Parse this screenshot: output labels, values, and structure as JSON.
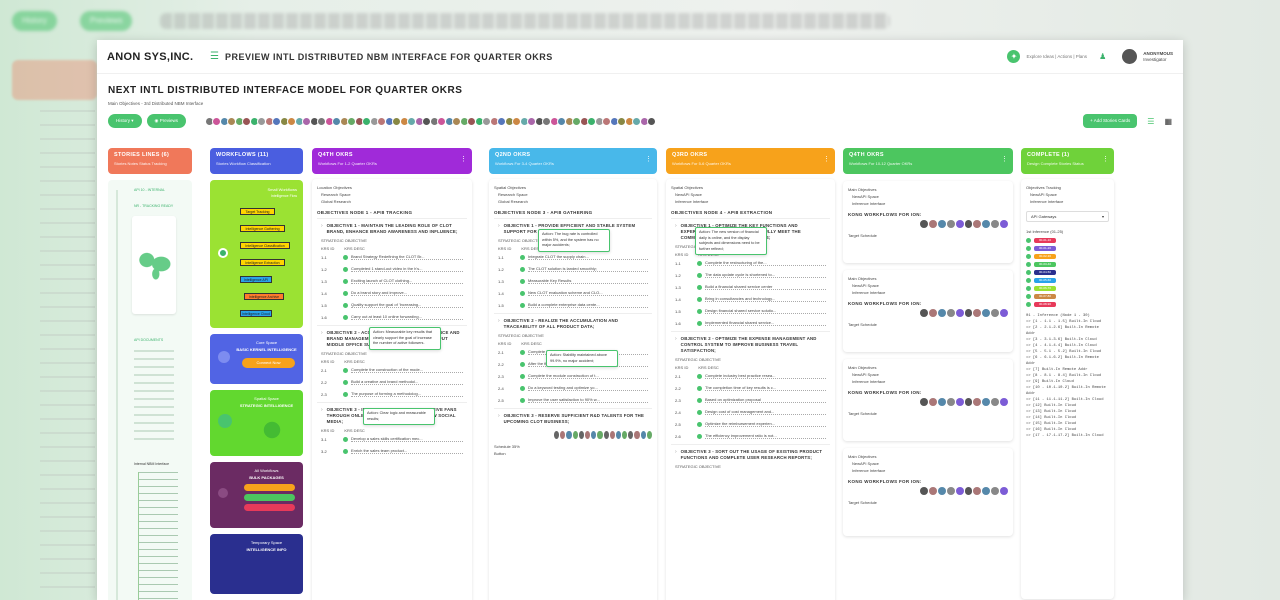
{
  "background": {
    "pills": [
      "History",
      "Previews"
    ]
  },
  "app": {
    "logo": "ANON SYS,INC.",
    "page_title": "PREVIEW INTL DISTRIBUTED NBM INTERFACE FOR QUARTER OKRS",
    "explore_text": "Explore Ideas | Actions | Plans",
    "user_name": "ANONYMOUS",
    "user_role": "Investigator"
  },
  "board": {
    "title": "NEXT INTL DISTRIBUTED INTERFACE MODEL FOR QUARTER OKRS",
    "subtitle": "Main Objectives - 3rd Distributed NBM Interface",
    "history_label": "History",
    "previews_label": "Previews",
    "add_card_label": "Add Stories Cards"
  },
  "colors": {
    "accent": "#49c46e",
    "stories": "#f0785a",
    "workflows": "#4a5ee0",
    "okr_purple": "#a02ad9",
    "okr_blue": "#48b8ea",
    "okr_orange": "#f7a21b",
    "okr_green": "#4cc65f",
    "complete": "#6fd23a"
  },
  "columns": {
    "stories": {
      "title": "STORIES LINES (6)",
      "subtitle": "Stories Notes Status Tracking",
      "items": [
        "API 10 - INTERNAL",
        "NR - TRACKING READY",
        "API DOCUMENTS",
        "Internal NBM Interface"
      ]
    },
    "workflows": {
      "title": "WORKFLOWS (11)",
      "subtitle": "Stories Workflow Classification",
      "flow_title": "Small Workflows",
      "flow_sub": "Intelligence Flow",
      "flow_steps": [
        "Target Tracking",
        "Intelligence Gathering",
        "Intelligence Classification",
        "Intelligence Extraction",
        "Intelligence API",
        "Intelligence Archive",
        "Intelligence Cloud"
      ],
      "card2_title": "Core Space",
      "card2_sub": "BASIC KERNEL INTELLIGENCE",
      "card2_btn": "Connect Now",
      "card3_title": "Spatial Space",
      "card3_sub": "STRATEGIC INTELLIGENCE",
      "card4_title": "All Workflows",
      "card4_sub": "BULK PACKAGES",
      "card5_title": "Temporary Space",
      "card5_sub": "INTELLIGENCE INFO"
    },
    "okr1": {
      "title": "Q4TH OKRS",
      "subtitle": "Workflows For 1-2 Quarter OKRs",
      "meta": [
        "Location Objectives",
        "Research Space",
        "Global Research"
      ],
      "section": "OBJECTIVES NODE 1 - API8 TRACKING",
      "objectives": [
        {
          "title": "OBJECTIVE 1 - MAINTAIN THE LEADING ROLE OF CLOT BRAND, ENHANCE BRAND AWARENESS AND INFLUENCE;",
          "strategic": "STRATEGIC OBJECTIVE",
          "kr_id": "KRS ID",
          "kr_desc": "KRS DESC",
          "krs": [
            [
              "1-1",
              "Brand Strategy Redefining the CLOT Br..."
            ],
            [
              "1-2",
              "Completed 1 stand-out video in the h's..."
            ],
            [
              "1-3",
              "Exciting launch of CLOT clothing..."
            ],
            [
              "1-4",
              "Do a brand story and improve..."
            ],
            [
              "1-5",
              "Quality support the goal of 'Increasing..."
            ],
            [
              "1-6",
              "Carry out at least 10 online forwarding..."
            ]
          ],
          "tip": "Action: Measurable key results that clearly support the goal of increase the number of active followers."
        },
        {
          "title": "OBJECTIVE 2 - ACCUMULATE CREATIVE EXPERIENCE AND BRAND MANAGEMENT METHODOLOGY, AND OUTPUT MIDDLE OFFICE SUPPORT CAPABILITIES;",
          "strategic": "STRATEGIC OBJECTIVE",
          "kr_id": "KRS ID",
          "kr_desc": "KRS DESC",
          "krs": [
            [
              "2-1",
              "Complete the construction of the mode..."
            ],
            [
              "2-2",
              "Build a creative and brand methodol..."
            ],
            [
              "2-3",
              "The purpose of forming a methodolog..."
            ]
          ],
          "tip": "Action: Clear logic and measurable results;"
        },
        {
          "title": "OBJECTIVE 3 - INCREASE THE NUMBER OF ACTIVE FANS THROUGH ONLINE TRAFFIC ACTIVITIES ON NEW SOCIAL MEDIA;",
          "strategic": "",
          "kr_id": "KRS ID",
          "kr_desc": "KRS DESC",
          "krs": [
            [
              "3-1",
              "Develop a sales skills certification mec..."
            ],
            [
              "3-2",
              "Enrich the sales team product..."
            ]
          ],
          "tip": ""
        }
      ]
    },
    "okr2": {
      "title": "Q2ND OKRS",
      "subtitle": "Workflows For 3-4 Quarter OKRs",
      "meta": [
        "Spatial Objectives",
        "Research Space",
        "Global Research"
      ],
      "section": "OBJECTIVES NODE 3 - API8 GATHERING",
      "objectives": [
        {
          "title": "OBJECTIVE 1 - PROVIDE EFFICIENT AND STABLE SYSTEM SUPPORT FOR CLOT BUSINESS;",
          "strategic": "STRATEGIC OBJECTIVE",
          "kr_id": "KRS ID",
          "kr_desc": "KRS DESC",
          "krs": [
            [
              "1-1",
              "Integrate CLOT the supply chain..."
            ],
            [
              "1-2",
              "The CLOT solution is landed smoothly;"
            ],
            [
              "1-3",
              "Measurable Key Results"
            ],
            [
              "1-4",
              "New CLOT evaluation scheme and CLO..."
            ],
            [
              "1-5",
              "Build a complete enterprise data cente..."
            ]
          ],
          "tip": "Action: The bug rate is controlled within 5%, and the system has no major accidents;"
        },
        {
          "title": "OBJECTIVE 2 - REALIZE THE ACCUMULATION AND TRACEABILITY OF ALL PRODUCT DATA;",
          "strategic": "STRATEGIC OBJECTIVE",
          "kr_id": "KRS ID",
          "kr_desc": "KRS DESC",
          "krs": [
            [
              "2-1",
              "Complete data middle platform frame..."
            ],
            [
              "2-2",
              "After the first-generation version is rea..."
            ],
            [
              "2-3",
              "Complete the module construction of t..."
            ],
            [
              "2-4",
              "Do a keyword testing and optimize yo..."
            ],
            [
              "2-5",
              "Improve the user satisfaction to 90% w..."
            ]
          ],
          "tip": "Action: Stability maintained above 99.9%, no major accident;"
        },
        {
          "title": "OBJECTIVE 3 - RESERVE SUFFICIENT R&D TALENTS FOR THE UPCOMING CLOT BUSINESS;",
          "strategic": "",
          "kr_id": "",
          "kr_desc": "",
          "krs": [],
          "tip": ""
        }
      ],
      "footer_label": "Schedule 35%",
      "footer_btn": "Button"
    },
    "okr3": {
      "title": "Q3RD OKRS",
      "subtitle": "Workflows For 5-6 Quarter OKRs",
      "meta": [
        "Spatial Objectives",
        "NewAPI Space",
        "Inference Interface"
      ],
      "section": "OBJECTIVES NODE 4 - API8 EXTRACTION",
      "objectives": [
        {
          "title": "OBJECTIVE 1 - OPTIMIZE THE KEY FUNCTIONS AND EXPERIENCE OF THE PRODUCT TO FULLY MEET THE COMMERCIALIZATION REQUIREMENTS;",
          "strategic": "STRATEGIC OBJECTIVE",
          "kr_id": "KRS ID",
          "kr_desc": "KRS DESC",
          "krs": [
            [
              "1-1",
              "Complete the restructuring of the..."
            ],
            [
              "1-2",
              "The data update cycle is shortened to..."
            ],
            [
              "1-3",
              "Build a financial shared service center"
            ],
            [
              "1-4",
              "Bring in consultancies and technology..."
            ],
            [
              "1-5",
              "Design financial shared service solutio..."
            ],
            [
              "1-6",
              "Implemented financial shared service..."
            ]
          ],
          "tip": "Action: The new version of financial daily is online, and the display subjects and dimensions need to be further refined;"
        },
        {
          "title": "OBJECTIVE 2 - OPTIMIZE THE EXPENSE MANAGEMENT AND CONTROL SYSTEM TO IMPROVE BUSINESS TRAVEL SATISFACTION;",
          "strategic": "STRATEGIC OBJECTIVE",
          "kr_id": "KRS ID",
          "kr_desc": "KRS DESC",
          "krs": [
            [
              "2-1",
              "Complete industry best practice resea..."
            ],
            [
              "2-2",
              "The completion time of key results is c..."
            ],
            [
              "2-3",
              "Based on optimization proposal"
            ],
            [
              "2-4",
              "Design cost of cost management and..."
            ],
            [
              "2-5",
              "Optimize the reimbursement experien..."
            ],
            [
              "2-6",
              "The efficiency improvement ratio is not..."
            ]
          ],
          "tip": ""
        },
        {
          "title": "OBJECTIVE 3 - SORT OUT THE USAGE OF EXISTING PRODUCT FUNCTIONS AND COMPLETE USER RESEARCH REPORTS;",
          "strategic": "STRATEGIC OBJECTIVE",
          "kr_id": "",
          "kr_desc": "",
          "krs": [],
          "tip": ""
        }
      ]
    },
    "okr4": {
      "title": "Q4TH OKRS",
      "subtitle": "Workflows For 10-12 Quarter OKRs",
      "cards": [
        {
          "meta": [
            "Main Objectives",
            "NewAPI Space",
            "Inference Interface"
          ],
          "label": "KONG WORKFLOWS FOR ION:",
          "foot": "Target Schedule"
        },
        {
          "meta": [
            "Main Objectives",
            "NewAPI Space",
            "Inference Interface"
          ],
          "label": "KONG WORKFLOWS FOR ION:",
          "foot": "Target Schedule"
        },
        {
          "meta": [
            "Main Objectives",
            "NewAPI Space",
            "Inference Interface"
          ],
          "label": "KONG WORKFLOWS FOR ION:",
          "foot": "Target Schedule"
        },
        {
          "meta": [
            "Main Objectives",
            "NewAPI Space",
            "Inference Interface"
          ],
          "label": "KONG WORKFLOWS FOR ION:",
          "foot": "Target Schedule"
        }
      ]
    },
    "complete": {
      "title": "COMPLETE (1)",
      "subtitle": "Design Complete Stories Status",
      "meta": [
        "Objectives Tracking",
        "NewAPI Space",
        "Inference Interface"
      ],
      "dropdown": "API Gateways",
      "list_title": "1st Inference (01-25)",
      "tags": [
        "00-01-10",
        "00-01-20",
        "00-02-30",
        "00-03-40",
        "00-04-50",
        "00-05-60",
        "00-06-70",
        "00-07-80",
        "00-08-90"
      ],
      "lines": [
        "01 - Inference (Node 1 - 30)",
        "=> [1 - 1.1 - 1.5] Built-In Cloud",
        "=> [2 - 2.1-2.6] Built-In Remote Addr",
        "=> [3 - 3.1-3.6] Built-In Cloud",
        "=> [4 - 4.1-4.4] Built-In Cloud",
        "=> [5 - 5.1 - 5.2] Built-In Cloud",
        "=> [6 - 6.1-6.2] Built-In Remote Addr",
        "=> [7] Built-In Remote Addr",
        "=> [8 - 8.1 - 8.4] Built-In Cloud",
        "=> [9] Built-In Cloud",
        "=> [10 - 10.1-10.2] Built-In Remote Addr",
        "=> [11 - 11.1-11.2] Built-In Cloud",
        "=> [12] Built-In Cloud",
        "=> [13] Built-In Cloud",
        "=> [14] Built-In Cloud",
        "=> [15] Built-In Cloud",
        "=> [16] Built-In Cloud",
        "=> [17 - 17.1-17.2] Built-In Cloud"
      ]
    }
  }
}
